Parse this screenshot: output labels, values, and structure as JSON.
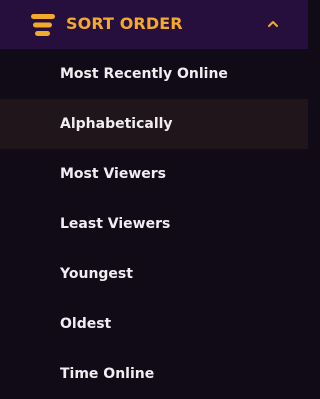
{
  "colors": {
    "header_bg": "#260f3d",
    "accent": "#f3aa2c",
    "panel_bg": "#110b18",
    "selected_bg": "#1f151b",
    "text": "#f1eef2"
  },
  "header": {
    "icon": "sort-lines-icon",
    "title": "SORT ORDER",
    "toggle_icon": "chevron-up-icon"
  },
  "options": [
    {
      "label": "Most Recently Online",
      "selected": false
    },
    {
      "label": "Alphabetically",
      "selected": true
    },
    {
      "label": "Most Viewers",
      "selected": false
    },
    {
      "label": "Least Viewers",
      "selected": false
    },
    {
      "label": "Youngest",
      "selected": false
    },
    {
      "label": "Oldest",
      "selected": false
    },
    {
      "label": "Time Online",
      "selected": false
    }
  ]
}
